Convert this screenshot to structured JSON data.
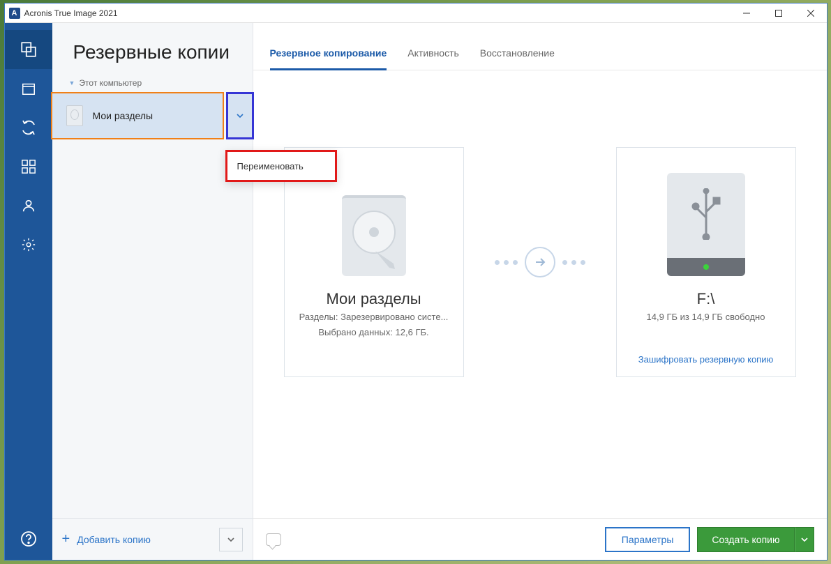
{
  "window_title": "Acronis True Image 2021",
  "app_icon_letter": "A",
  "sidebar": {
    "heading": "Резервные копии",
    "tree_header": "Этот компьютер",
    "selected_item_label": "Мои разделы",
    "context_menu_item": "Переименовать",
    "add_backup_label": "Добавить копию"
  },
  "tabs": {
    "backup": "Резервное копирование",
    "activity": "Активность",
    "recovery": "Восстановление"
  },
  "source_card": {
    "title": "Мои разделы",
    "line1": "Разделы: Зарезервировано систе...",
    "line2": "Выбрано данных: 12,6 ГБ."
  },
  "dest_card": {
    "title": "F:\\",
    "line1": "14,9 ГБ из 14,9 ГБ свободно",
    "encrypt": "Зашифровать резервную копию"
  },
  "footer": {
    "params": "Параметры",
    "create": "Создать копию"
  }
}
